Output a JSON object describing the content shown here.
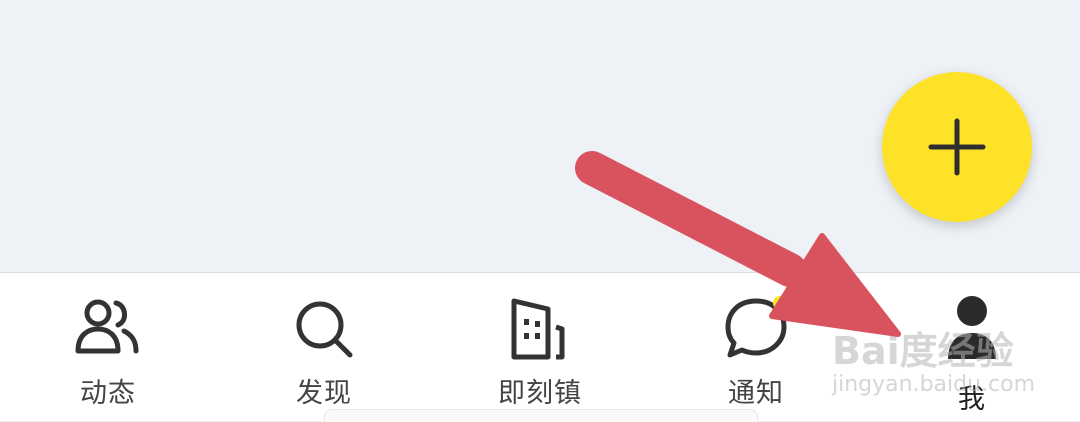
{
  "tabs": [
    {
      "label": "动态",
      "icon": "people-icon"
    },
    {
      "label": "发现",
      "icon": "search-icon"
    },
    {
      "label": "即刻镇",
      "icon": "building-icon"
    },
    {
      "label": "通知",
      "icon": "chat-bubble-icon"
    },
    {
      "label": "我",
      "icon": "person-icon"
    }
  ],
  "fab": {
    "icon": "plus-icon",
    "color": "#fde228"
  },
  "notification_dot_color": "#fde228",
  "annotation": {
    "icon": "arrow-icon",
    "color": "#d9535f"
  },
  "watermark": {
    "main": "Bai度经验",
    "sub": "jingyan.baidu.com"
  }
}
